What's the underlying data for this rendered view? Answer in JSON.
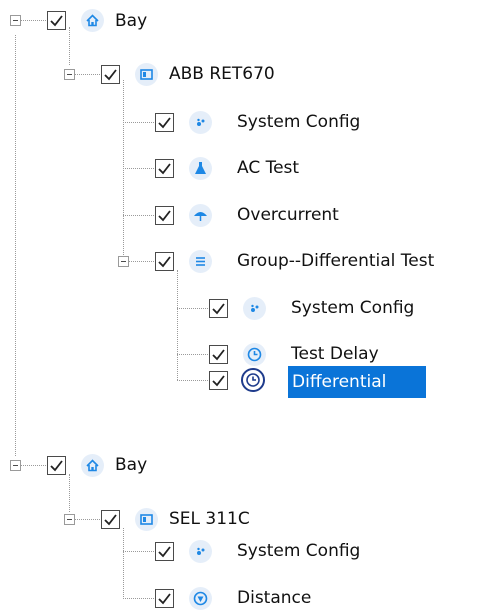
{
  "tree": {
    "nodes": [
      {
        "label": "Bay",
        "icon": "home-icon",
        "checked": true,
        "expanded": true
      },
      {
        "label": "ABB RET670",
        "icon": "device-icon",
        "checked": true,
        "expanded": true
      },
      {
        "label": "System Config",
        "icon": "system-config-icon",
        "checked": true
      },
      {
        "label": "AC Test",
        "icon": "ac-test-icon",
        "checked": true
      },
      {
        "label": "Overcurrent",
        "icon": "overcurrent-icon",
        "checked": true
      },
      {
        "label": "Group--Differential Test",
        "icon": "group-list-icon",
        "checked": true,
        "expanded": true
      },
      {
        "label": "System Config",
        "icon": "system-config-icon",
        "checked": true
      },
      {
        "label": "Test Delay",
        "icon": "clock-icon",
        "checked": true
      },
      {
        "label": "Differential",
        "icon": "clock-icon",
        "checked": true,
        "selected": true
      },
      {
        "label": "Bay",
        "icon": "home-icon",
        "checked": true,
        "expanded": true
      },
      {
        "label": "SEL 311C",
        "icon": "device-icon",
        "checked": true,
        "expanded": true
      },
      {
        "label": "System Config",
        "icon": "system-config-icon",
        "checked": true
      },
      {
        "label": "Distance",
        "icon": "distance-icon",
        "checked": true
      }
    ]
  },
  "colors": {
    "selection": "#0a74d8",
    "icon_blue": "#1e88e5",
    "icon_bg": "#e5eef9"
  }
}
